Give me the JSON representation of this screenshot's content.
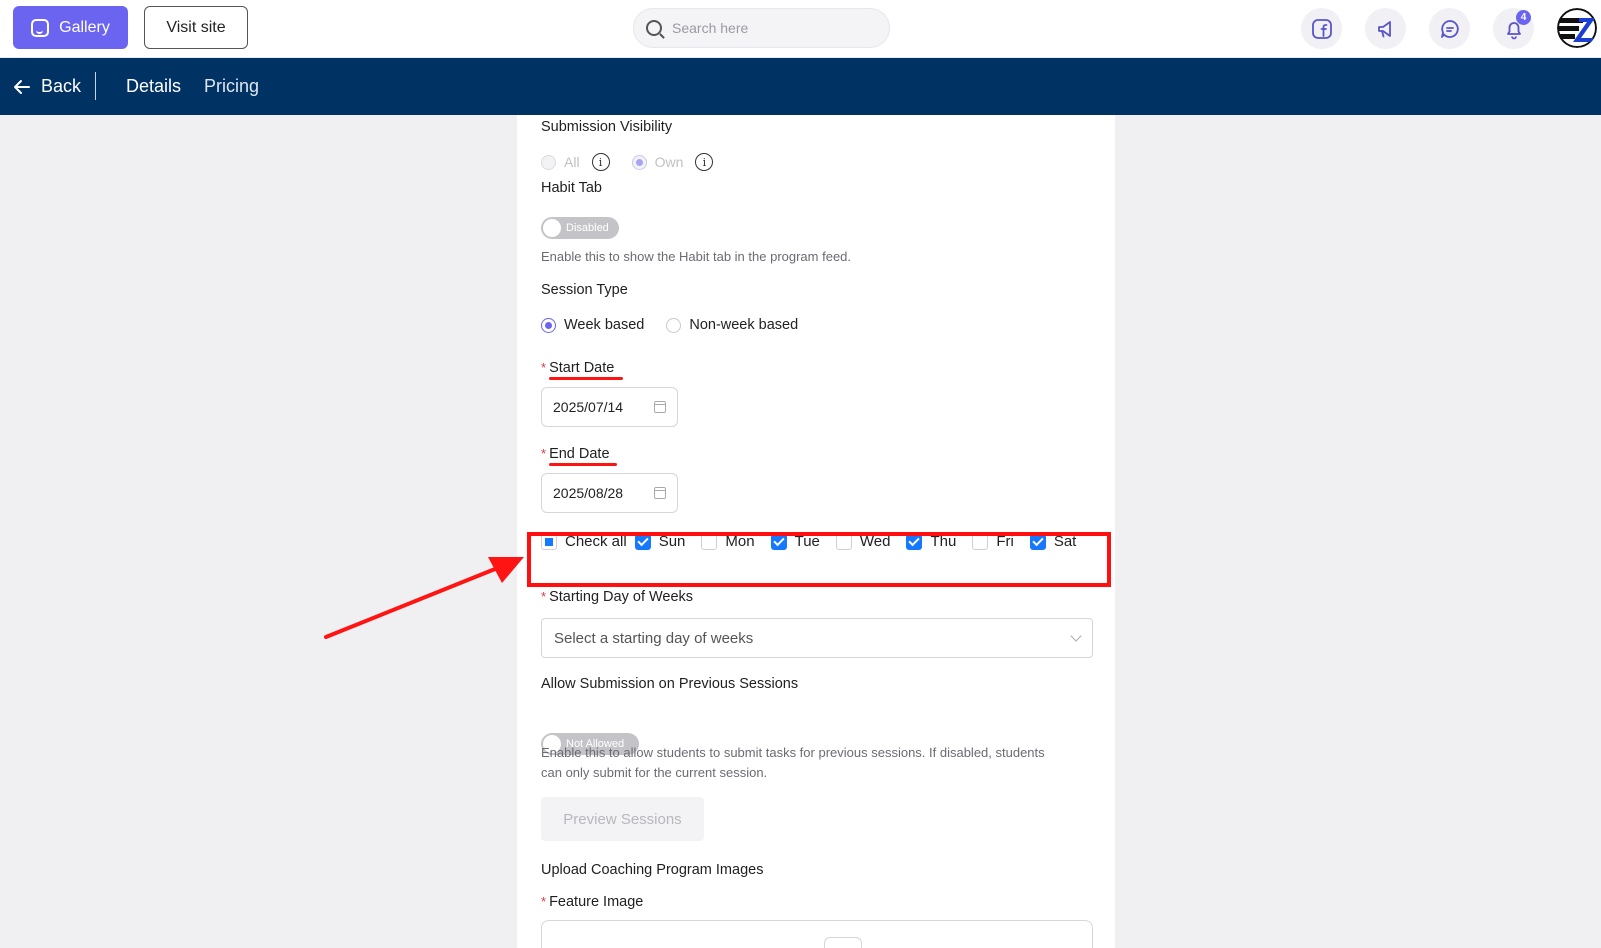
{
  "topbar": {
    "gallery_label": "Gallery",
    "visit_label": "Visit site",
    "search_placeholder": "Search here",
    "notification_count": "4"
  },
  "navbar": {
    "back_label": "Back",
    "tabs": [
      {
        "label": "Details"
      },
      {
        "label": "Pricing"
      }
    ]
  },
  "form": {
    "submission_visibility": {
      "label": "Submission Visibility",
      "options": [
        "All",
        "Own"
      ],
      "selected": "Own"
    },
    "habit_tab": {
      "label": "Habit Tab",
      "toggle_text": "Disabled",
      "help": "Enable this to show the Habit tab in the program feed."
    },
    "session_type": {
      "label": "Session Type",
      "options": [
        "Week based",
        "Non-week based"
      ],
      "selected": "Week based"
    },
    "start_date": {
      "label": "Start Date",
      "value": "2025/07/14"
    },
    "end_date": {
      "label": "End Date",
      "value": "2025/08/28"
    },
    "days": {
      "check_all_label": "Check all",
      "items": [
        {
          "label": "Sun",
          "checked": true
        },
        {
          "label": "Mon",
          "checked": false
        },
        {
          "label": "Tue",
          "checked": true
        },
        {
          "label": "Wed",
          "checked": false
        },
        {
          "label": "Thu",
          "checked": true
        },
        {
          "label": "Fri",
          "checked": false
        },
        {
          "label": "Sat",
          "checked": true
        }
      ]
    },
    "starting_day": {
      "label": "Starting Day of Weeks",
      "placeholder": "Select a starting day of weeks"
    },
    "allow_previous": {
      "label": "Allow Submission on Previous Sessions",
      "toggle_text": "Not Allowed",
      "help_line1": "Enable this to allow students to submit tasks for previous sessions. If disabled, students",
      "help_line2": "can only submit for the current session."
    },
    "preview_label": "Preview Sessions",
    "upload_heading": "Upload Coaching Program Images",
    "feature_image_label": "Feature Image"
  },
  "colors": {
    "accent": "#6b64f0",
    "navbar": "#003263",
    "annotation": "#ff0f0f",
    "checkbox": "#1677ff"
  }
}
